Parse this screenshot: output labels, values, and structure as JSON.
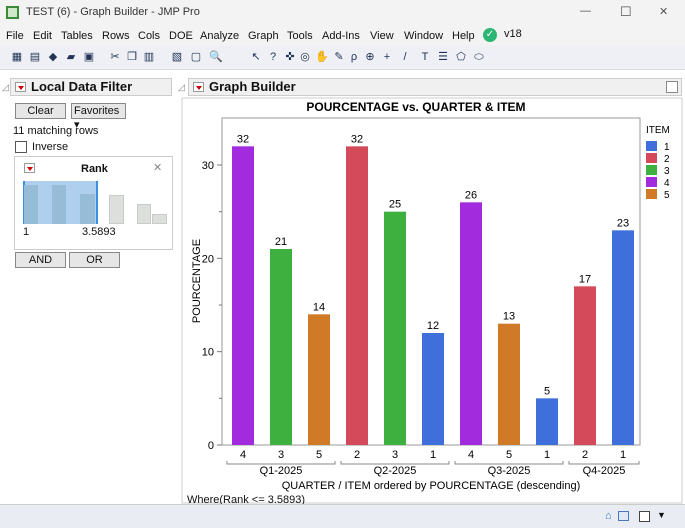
{
  "window": {
    "title": "TEST (6) - Graph Builder - JMP Pro",
    "minimize": "—",
    "maximize": "☐",
    "close": "✕"
  },
  "menu": [
    "File",
    "Edit",
    "Tables",
    "Rows",
    "Cols",
    "DOE",
    "Analyze",
    "Graph",
    "Tools",
    "Add-Ins",
    "View",
    "Window",
    "Help"
  ],
  "version": "v18",
  "filter": {
    "title": "Local Data Filter",
    "clear": "Clear",
    "favorites": "Favorites",
    "matching": "11 matching rows",
    "inverse": "Inverse",
    "column": "Rank",
    "min": "1",
    "max": "3.5893",
    "and": "AND",
    "or": "OR"
  },
  "graph": {
    "title": "Graph Builder",
    "chart_title": "POURCENTAGE vs. QUARTER & ITEM",
    "where": "Where(Rank <= 3.5893)"
  },
  "colors": {
    "1": "#3F6FDB",
    "2": "#D44A5A",
    "3": "#3DB03F",
    "4": "#A12BDD",
    "5": "#D07A28"
  },
  "chart_data": {
    "type": "bar",
    "title": "POURCENTAGE vs. QUARTER & ITEM",
    "xlabel": "QUARTER / ITEM ordered by POURCENTAGE (descending)",
    "ylabel": "POURCENTAGE",
    "ylim": [
      0,
      35
    ],
    "yticks": [
      0,
      10,
      20,
      30
    ],
    "legend": {
      "title": "ITEM",
      "items": [
        "1",
        "2",
        "3",
        "4",
        "5"
      ],
      "placement": "right"
    },
    "groups": [
      {
        "name": "Q1-2025",
        "bars": [
          {
            "item": "4",
            "value": 32
          },
          {
            "item": "3",
            "value": 21
          },
          {
            "item": "5",
            "value": 14
          }
        ]
      },
      {
        "name": "Q2-2025",
        "bars": [
          {
            "item": "2",
            "value": 32
          },
          {
            "item": "3",
            "value": 25
          },
          {
            "item": "1",
            "value": 12
          }
        ]
      },
      {
        "name": "Q3-2025",
        "bars": [
          {
            "item": "4",
            "value": 26
          },
          {
            "item": "5",
            "value": 13
          },
          {
            "item": "1",
            "value": 5
          }
        ]
      },
      {
        "name": "Q4-2025",
        "bars": [
          {
            "item": "2",
            "value": 17
          },
          {
            "item": "1",
            "value": 23
          }
        ]
      }
    ]
  }
}
